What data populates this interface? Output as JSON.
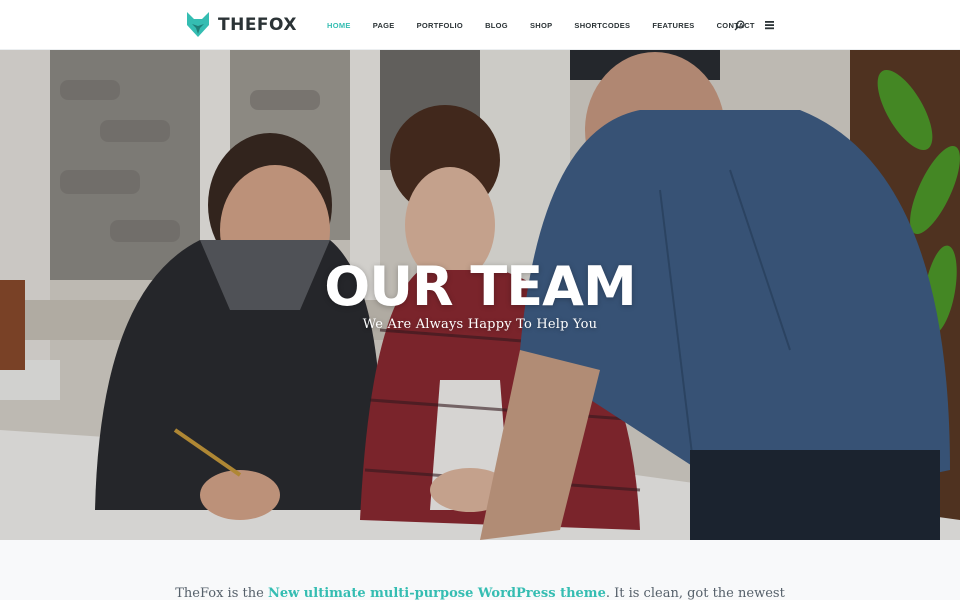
{
  "brand": {
    "name": "THEFOX",
    "logo_icon": "fox-head-icon",
    "accent_color": "#35bdb2"
  },
  "nav": {
    "items": [
      {
        "label": "HOME",
        "active": true
      },
      {
        "label": "PAGE"
      },
      {
        "label": "PORTFOLIO"
      },
      {
        "label": "BLOG"
      },
      {
        "label": "SHOP"
      },
      {
        "label": "SHORTCODES"
      },
      {
        "label": "FEATURES"
      },
      {
        "label": "CONTACT"
      }
    ],
    "icons": [
      "search-icon",
      "hamburger-menu-icon"
    ]
  },
  "hero": {
    "title": "OUR TEAM",
    "subtitle": "We Are Always Happy To Help You",
    "photo": "team-photo"
  },
  "intro": {
    "before": "TheFox is the ",
    "highlight": "New ultimate multi-purpose WordPress theme",
    "after": ". It is clean, got the newest"
  }
}
